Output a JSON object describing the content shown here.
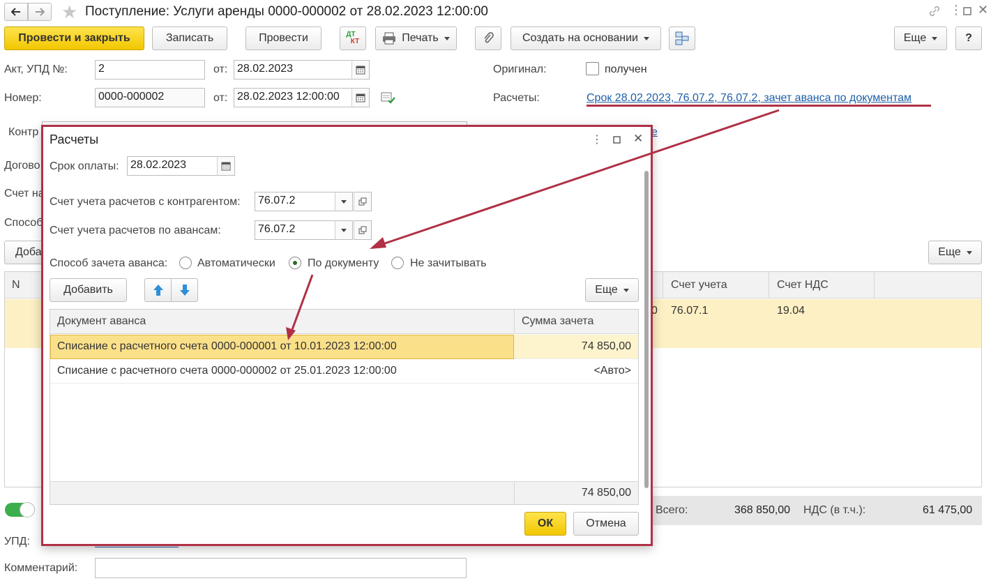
{
  "window": {
    "title": "Поступление: Услуги аренды 0000-000002 от 28.02.2023 12:00:00"
  },
  "toolbar": {
    "post_close": "Провести и закрыть",
    "save": "Записать",
    "post": "Провести",
    "dt_kt_top": "ДТ",
    "dt_kt_bottom": "КТ",
    "print": "Печать",
    "create_based": "Создать на основании",
    "more": "Еще",
    "help": "?"
  },
  "form": {
    "act_label": "Акт, УПД №:",
    "act_value": "2",
    "from_label": "от:",
    "act_date": "28.02.2023",
    "number_label": "Номер:",
    "number_value": "0000-000002",
    "number_from_label": "от:",
    "number_date": "28.02.2023 12:00:00",
    "original_label": "Оригинал:",
    "original_checkbox_label": "получен",
    "settlements_label": "Расчеты:",
    "settlements_link": "Срок 28.02.2023, 76.07.2, 76.07.2, зачет аванса по документам",
    "counterparty_label_partial": "Контр",
    "contract_label_partial": "Догово",
    "account_label_partial": "Счет на",
    "method_label_partial": "Способ",
    "add_partial": "Доба",
    "link_partial": "е",
    "table_more": "Еще",
    "table_columns": [
      "N",
      "Счет учета",
      "Счет НДС"
    ],
    "table_row": {
      "amount_tail": "0",
      "account": "76.07.1",
      "vat_account": "19.04"
    },
    "total_label": "Всего:",
    "total_value": "368 850,00",
    "vat_label": "НДС (в т.ч.):",
    "vat_value": "61 475,00",
    "upd_label": "УПД:",
    "comment_label": "Комментарий:"
  },
  "dialog": {
    "title": "Расчеты",
    "due_label": "Срок оплаты:",
    "due_value": "28.02.2023",
    "account_cp_label": "Счет учета расчетов с контрагентом:",
    "account_cp_value": "76.07.2",
    "account_adv_label": "Счет учета расчетов по авансам:",
    "account_adv_value": "76.07.2",
    "method_label": "Способ зачета аванса:",
    "method_options": [
      "Автоматически",
      "По документу",
      "Не зачитывать"
    ],
    "method_selected": "По документу",
    "add_button": "Добавить",
    "more_button": "Еще",
    "columns": {
      "doc": "Документ аванса",
      "sum": "Сумма зачета"
    },
    "rows": [
      {
        "doc": "Списание с расчетного счета 0000-000001 от 10.01.2023 12:00:00",
        "sum": "74 850,00"
      },
      {
        "doc": "Списание с расчетного счета 0000-000002 от 25.01.2023 12:00:00",
        "sum": "<Авто>"
      }
    ],
    "footer_total": "74 850,00",
    "ok_button": "ОК",
    "cancel_button": "Отмена"
  },
  "colors": {
    "accent_yellow": "#f2c700",
    "annotation_red": "#b03045",
    "link_blue": "#1d5fa8",
    "selected_row": "#fde8a0"
  }
}
